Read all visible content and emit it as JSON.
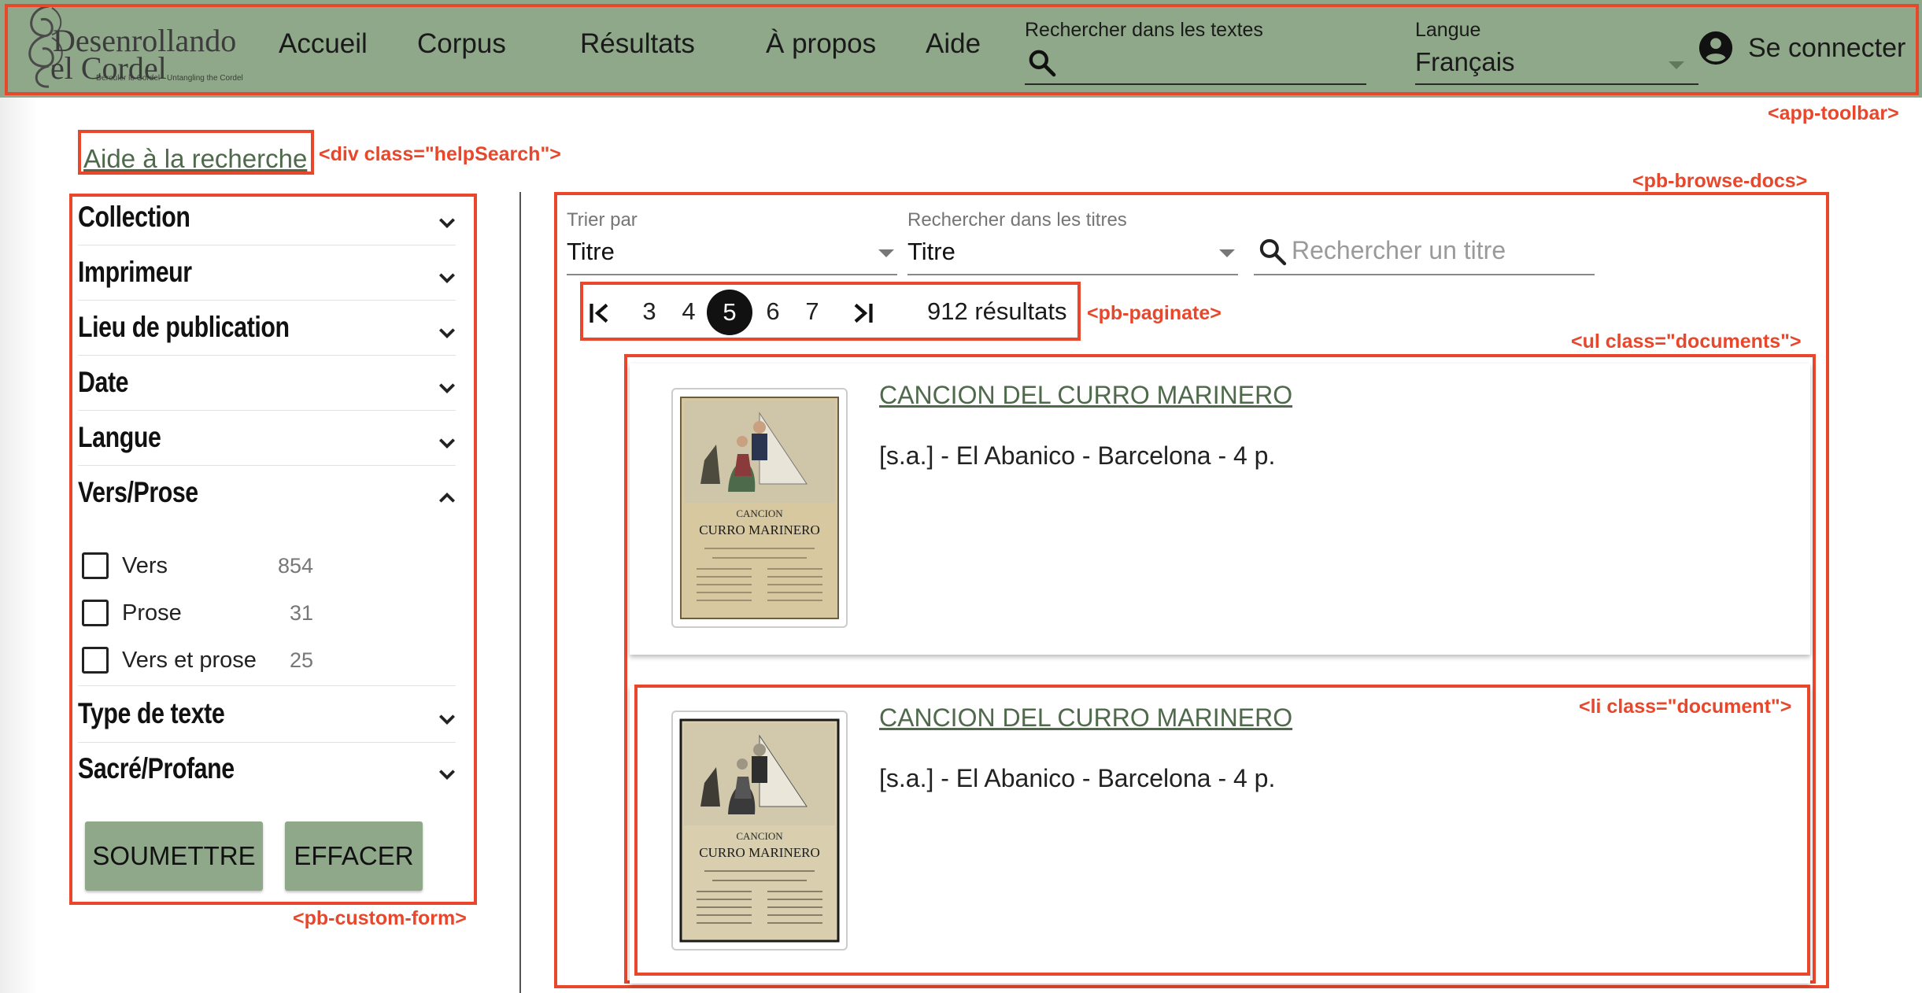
{
  "toolbar": {
    "logo_line1": "Desenrollando",
    "logo_line2": "el Cordel",
    "logo_tagline": "Dérouler le Cordel · Untangling the Cordel",
    "nav": [
      "Accueil",
      "Corpus",
      "Résultats",
      "À propos",
      "Aide"
    ],
    "search_label": "Rechercher dans les textes",
    "language_label": "Langue",
    "language_value": "Français",
    "login_label": "Se connecter"
  },
  "help_link": "Aide à la recherche",
  "facets": {
    "collapsed_top": [
      "Collection",
      "Imprimeur",
      "Lieu de publication",
      "Date",
      "Langue"
    ],
    "expanded_title": "Vers/Prose",
    "options": [
      {
        "label": "Vers",
        "count": "854"
      },
      {
        "label": "Prose",
        "count": "31"
      },
      {
        "label": "Vers et prose",
        "count": "25"
      }
    ],
    "collapsed_bottom": [
      "Type de texte",
      "Sacré/Profane"
    ],
    "submit": "SOUMETTRE",
    "clear": "EFFACER"
  },
  "browse": {
    "sort_label": "Trier par",
    "sort_value": "Titre",
    "search_titles_label": "Rechercher dans les titres",
    "search_titles_value": "Titre",
    "title_search_placeholder": "Rechercher un titre",
    "pages": [
      "3",
      "4",
      "5",
      "6",
      "7"
    ],
    "current_page": "5",
    "results": "912 résultats"
  },
  "documents": [
    {
      "title": "CANCION DEL CURRO MARINERO",
      "meta": "[s.a.] - El Abanico - Barcelona - 4 p.",
      "thumb_heading1": "CANCION",
      "thumb_heading2": "CURRO MARINERO"
    },
    {
      "title": "CANCION DEL CURRO MARINERO",
      "meta": "[s.a.] - El Abanico - Barcelona - 4 p.",
      "thumb_heading1": "CANCION",
      "thumb_heading2": "CURRO MARINERO"
    }
  ],
  "annotations": {
    "toolbar": "<app-toolbar>",
    "help": "<div class=\"helpSearch\">",
    "browse": "<pb-browse-docs>",
    "paginate": "<pb-paginate>",
    "documents": "<ul class=\"documents\">",
    "document": "<li class=\"document\">",
    "form": "<pb-custom-form>"
  },
  "colors": {
    "toolbar_bg": "#8fa889",
    "link": "#4e6a4b",
    "annotation_red": "#e8472c"
  }
}
